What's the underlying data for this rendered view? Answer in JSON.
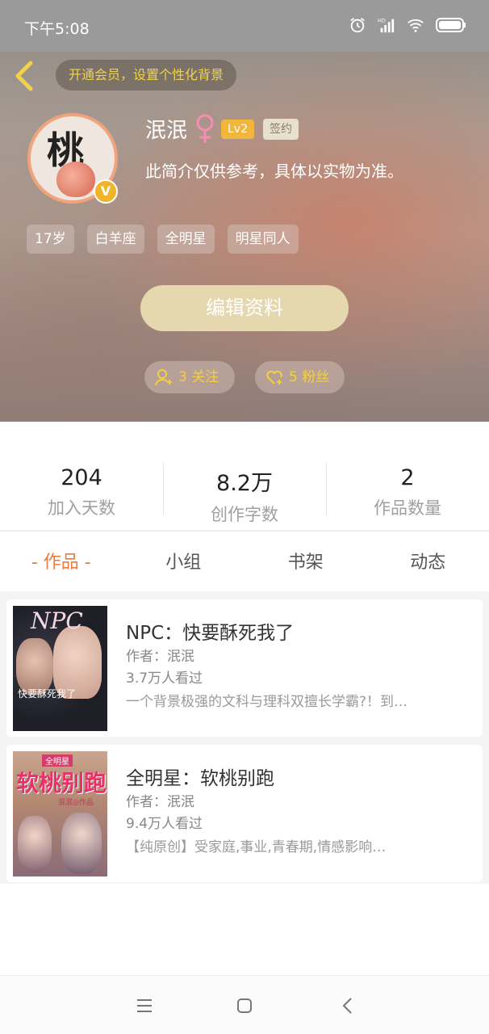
{
  "status_bar": {
    "time": "下午5:08",
    "signal_label": "HD"
  },
  "header": {
    "vip_promo": "开通会员，设置个性化背景",
    "avatar_char": "桃",
    "v_badge": "V",
    "username": "泯泯",
    "gender_symbol": "♀",
    "level": "Lv2",
    "signed_label": "签约",
    "bio": "此简介仅供参考，具体以实物为准。",
    "tags": [
      "17岁",
      "白羊座",
      "全明星",
      "明星同人"
    ],
    "edit_button": "编辑资料",
    "following": "3 关注",
    "followers": "5 粉丝"
  },
  "stats": [
    {
      "value": "204",
      "label": "加入天数"
    },
    {
      "value": "8.2万",
      "label": "创作字数"
    },
    {
      "value": "2",
      "label": "作品数量"
    }
  ],
  "tabs": [
    {
      "label": "- 作品 -",
      "active": true
    },
    {
      "label": "小组",
      "active": false
    },
    {
      "label": "书架",
      "active": false
    },
    {
      "label": "动态",
      "active": false
    }
  ],
  "books": [
    {
      "title": "NPC：快要酥死我了",
      "author": "作者：泯泯",
      "views": "3.7万人看过",
      "description": "一个背景极强的文科与理科双擅长学霸?！到…",
      "cover_title": "NPC",
      "cover_sub": "快要酥死我了"
    },
    {
      "title": "全明星：软桃别跑",
      "author": "作者：泯泯",
      "views": "9.4万人看过",
      "description": "【纯原创】受家庭,事业,青春期,情感影响…",
      "cover_title": "软桃别跑",
      "cover_top": "全明星",
      "cover_author": "泯泯◎作品"
    }
  ],
  "colors": {
    "accent": "#f07a3a",
    "gold": "#f4cf3f",
    "edit_button_bg": "#e5d7ae",
    "level_badge": "#f1b63b"
  }
}
